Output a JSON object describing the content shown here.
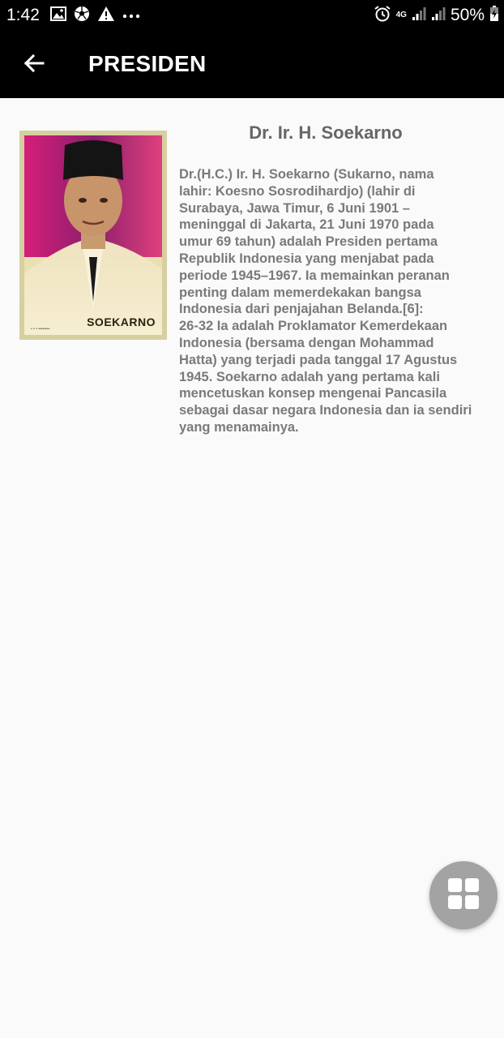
{
  "status_bar": {
    "time": "1:42",
    "network_type": "4G",
    "battery": "50%",
    "left_icons": [
      "image-icon",
      "soccer-ball-icon",
      "warning-icon",
      "more-dots-icon"
    ],
    "right_icons": [
      "alarm-icon",
      "signal-icon",
      "signal-icon",
      "battery-charging-icon"
    ]
  },
  "app_bar": {
    "title": "PRESIDEN",
    "back_icon": "arrow-back-icon",
    "background": "#000000"
  },
  "president": {
    "name": "Dr. Ir. H. Soekarno",
    "portrait_caption": "SOEKARNO",
    "bio": "Dr.(H.C.) Ir. H. Soekarno (Sukarno, nama\nlahir: Koesno Sosrodihardjo) (lahir di\nSurabaya, Jawa Timur, 6 Juni 1901 –\nmeninggal di Jakarta, 21 Juni 1970 pada\numur 69 tahun) adalah Presiden pertama\nRepublik Indonesia yang menjabat pada\nperiode 1945–1967. Ia memainkan peranan\npenting dalam memerdekakan bangsa\nIndonesia dari penjajahan Belanda.[6]:\n26-32 Ia adalah Proklamator Kemerdekaan\nIndonesia (bersama dengan Mohammad\nHatta) yang terjadi pada tanggal 17 Agustus\n1945. Soekarno adalah yang pertama kali\nmencetuskan konsep mengenai Pancasila\nsebagai dasar negara Indonesia dan ia sendiri\nyang menamainya."
  },
  "fab": {
    "icon": "grid-icon",
    "color": "#a3a3a3"
  }
}
